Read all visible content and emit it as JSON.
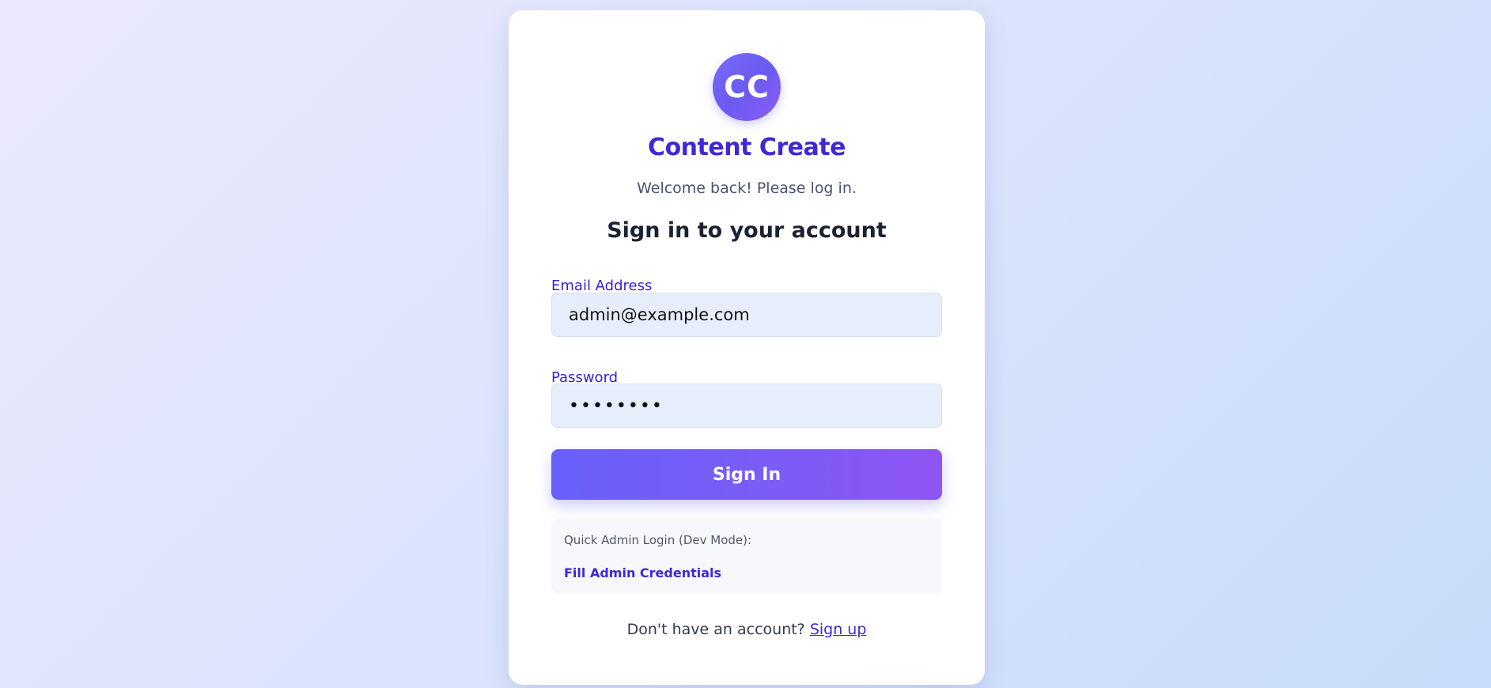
{
  "brand": {
    "logo_initials": "CC",
    "app_name": "Content Create",
    "welcome_text": "Welcome back! Please log in."
  },
  "form": {
    "heading": "Sign in to your account",
    "email_label": "Email Address",
    "email_value": "admin@example.com",
    "password_label": "Password",
    "password_masked": "••••••••",
    "submit_label": "Sign In"
  },
  "dev_mode": {
    "label": "Quick Admin Login (Dev Mode):",
    "fill_link": "Fill Admin Credentials"
  },
  "footer": {
    "prompt": "Don't have an account?",
    "signup_link": "Sign up"
  },
  "colors": {
    "accent": "#3f28d6",
    "button_start": "#6860fb",
    "button_end": "#8e55f4",
    "input_bg": "#e7eefb"
  }
}
